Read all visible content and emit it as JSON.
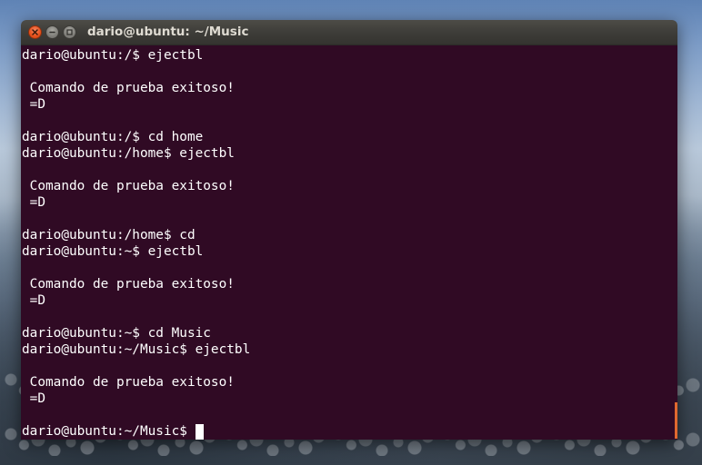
{
  "window": {
    "title": "dario@ubuntu: ~/Music",
    "controls": {
      "close_icon": "close-icon",
      "minimize_icon": "minimize-icon",
      "maximize_icon": "maximize-icon"
    }
  },
  "colors": {
    "terminal_bg": "#300a24",
    "terminal_fg": "#ffffff",
    "accent": "#e0682f",
    "titlebar": "#3e3d39"
  },
  "terminal": {
    "lines": [
      "dario@ubuntu:/$ ejectbl",
      "",
      " Comando de prueba exitoso!",
      " =D",
      "",
      "dario@ubuntu:/$ cd home",
      "dario@ubuntu:/home$ ejectbl",
      "",
      " Comando de prueba exitoso!",
      " =D",
      "",
      "dario@ubuntu:/home$ cd",
      "dario@ubuntu:~$ ejectbl",
      "",
      " Comando de prueba exitoso!",
      " =D",
      "",
      "dario@ubuntu:~$ cd Music",
      "dario@ubuntu:~/Music$ ejectbl",
      "",
      " Comando de prueba exitoso!",
      " =D",
      ""
    ],
    "prompt": "dario@ubuntu:~/Music$ "
  }
}
